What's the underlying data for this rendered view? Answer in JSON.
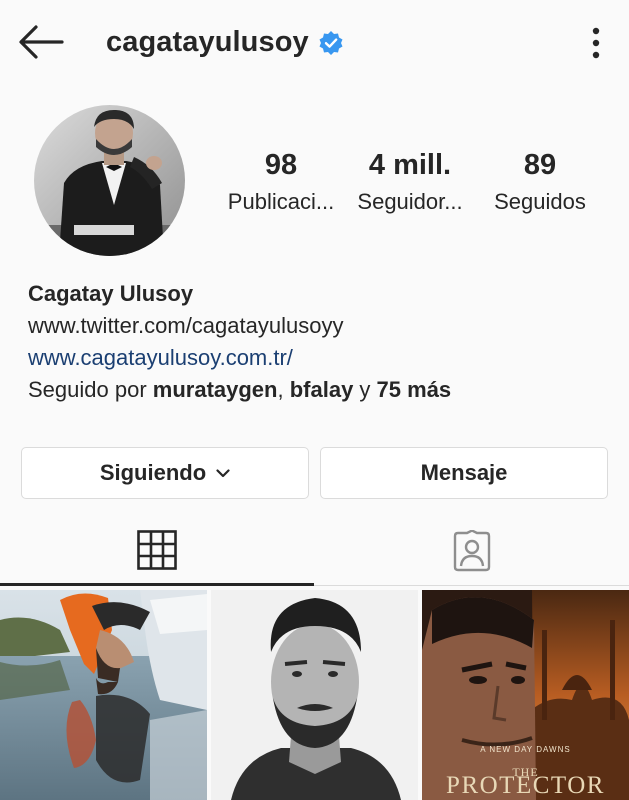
{
  "header": {
    "username": "cagatayulusoy",
    "verified": true,
    "back_icon": "arrow-left-icon",
    "more_icon": "more-vertical-icon"
  },
  "stats": {
    "posts": {
      "value": "98",
      "label": "Publicaci..."
    },
    "followers": {
      "value": "4 mill.",
      "label": "Seguidor..."
    },
    "following": {
      "value": "89",
      "label": "Seguidos"
    }
  },
  "bio": {
    "name": "Cagatay Ulusoy",
    "line1": "www.twitter.com/cagatayulusoyy",
    "website": "www.cagatayulusoy.com.tr/",
    "followed_prefix": "Seguido por ",
    "followed_user1": "murataygen",
    "followed_sep": ", ",
    "followed_user2": "bfalay",
    "followed_and": " y ",
    "followed_more": "75 más"
  },
  "actions": {
    "following_label": "Siguiendo",
    "message_label": "Mensaje"
  },
  "tabs": [
    {
      "icon": "grid-icon",
      "active": true
    },
    {
      "icon": "tagged-user-icon",
      "active": false
    }
  ],
  "posts": [
    {
      "icon": "photo-thumbnail"
    },
    {
      "icon": "photo-thumbnail"
    },
    {
      "icon": "photo-thumbnail",
      "poster_tagline": "A NEW DAY DAWNS",
      "poster_the": "THE",
      "poster_title": "PROTECTOR"
    }
  ],
  "colors": {
    "verified_badge": "#3897f0",
    "link_blue": "#1b3f72",
    "text": "#262626",
    "border": "#dbdbdb",
    "background": "#fafafa"
  }
}
